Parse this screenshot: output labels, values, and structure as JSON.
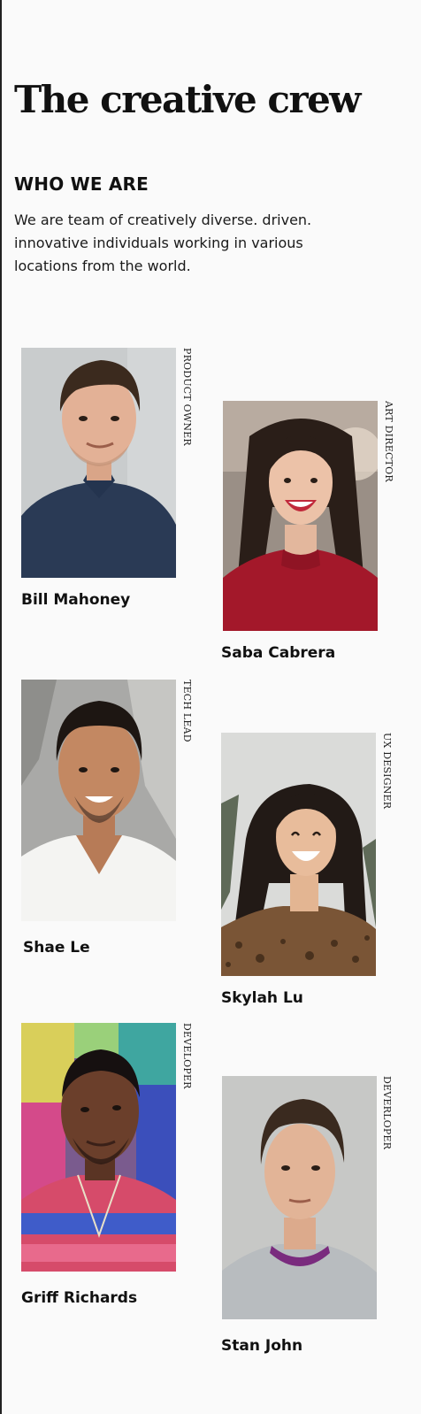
{
  "header": {
    "title": "The creative crew",
    "subtitle": "WHO WE ARE",
    "intro": "We are team of creatively diverse.  driven. innovative individuals working in various locations from the world."
  },
  "team": [
    {
      "name": "Bill Mahoney",
      "role": "PRODUCT OWNER"
    },
    {
      "name": "Saba Cabrera",
      "role": "ART DIRECTOR"
    },
    {
      "name": "Shae Le",
      "role": "TECH LEAD"
    },
    {
      "name": "Skylah Lu",
      "role": "UX DESIGNER"
    },
    {
      "name": "Griff Richards",
      "role": "DEVELOPER"
    },
    {
      "name": "Stan John",
      "role": "DEVERLOPER"
    }
  ]
}
